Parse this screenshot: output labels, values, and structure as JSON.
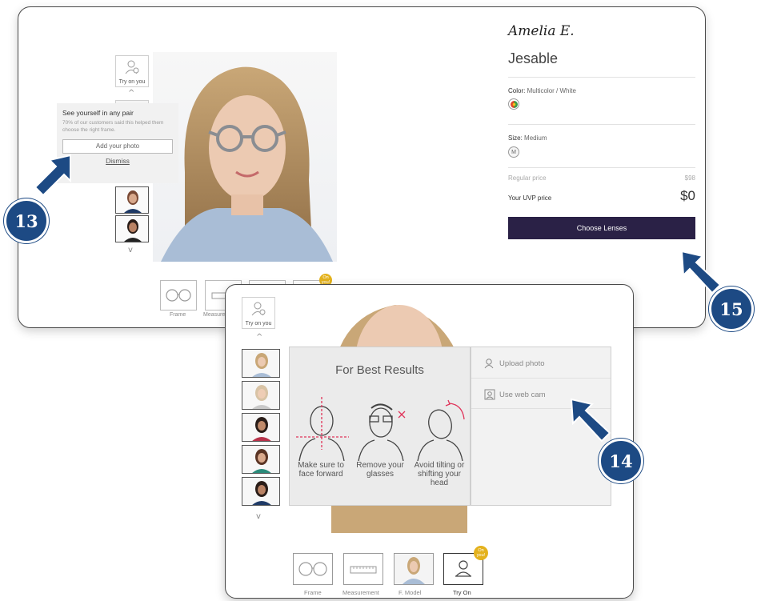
{
  "colors": {
    "callout_blue": "#1d4a84",
    "button_navy": "#2a2146",
    "badge_gold": "#e4b21d"
  },
  "panel1": {
    "tryon_label": "Try on you",
    "caret_up": "^",
    "caret_down": "v",
    "popup": {
      "title": "See yourself in any pair",
      "text": "70% of our customers said this helped them choose the right frame.",
      "add_photo_label": "Add your photo",
      "dismiss_label": "Dismiss"
    },
    "product": {
      "brand": "Amelia E.",
      "name": "Jesable",
      "color_label": "Color:",
      "color_value": "Multicolor / White",
      "size_label": "Size:",
      "size_value": "Medium",
      "size_swatch": "M",
      "regular_price_label": "Regular price",
      "regular_price": "$98",
      "uvp_price_label": "Your UVP price",
      "uvp_price": "$0",
      "choose_lenses_label": "Choose Lenses"
    },
    "tabs": [
      "Frame",
      "Measure"
    ],
    "badge": "On you!"
  },
  "panel2": {
    "tryon_label": "Try on you",
    "caret_up": "^",
    "caret_down": "v",
    "best_results": {
      "title": "For Best Results",
      "tips": [
        "Make sure to face forward",
        "Remove your glasses",
        "Avoid tilting or shifting your head"
      ]
    },
    "options": {
      "upload_label": "Upload photo",
      "webcam_label": "Use web cam"
    },
    "tabs": [
      "Frame",
      "Measurement",
      "F. Model",
      "Try On"
    ],
    "badge": "On you!"
  },
  "callouts": [
    "13",
    "14",
    "15"
  ]
}
